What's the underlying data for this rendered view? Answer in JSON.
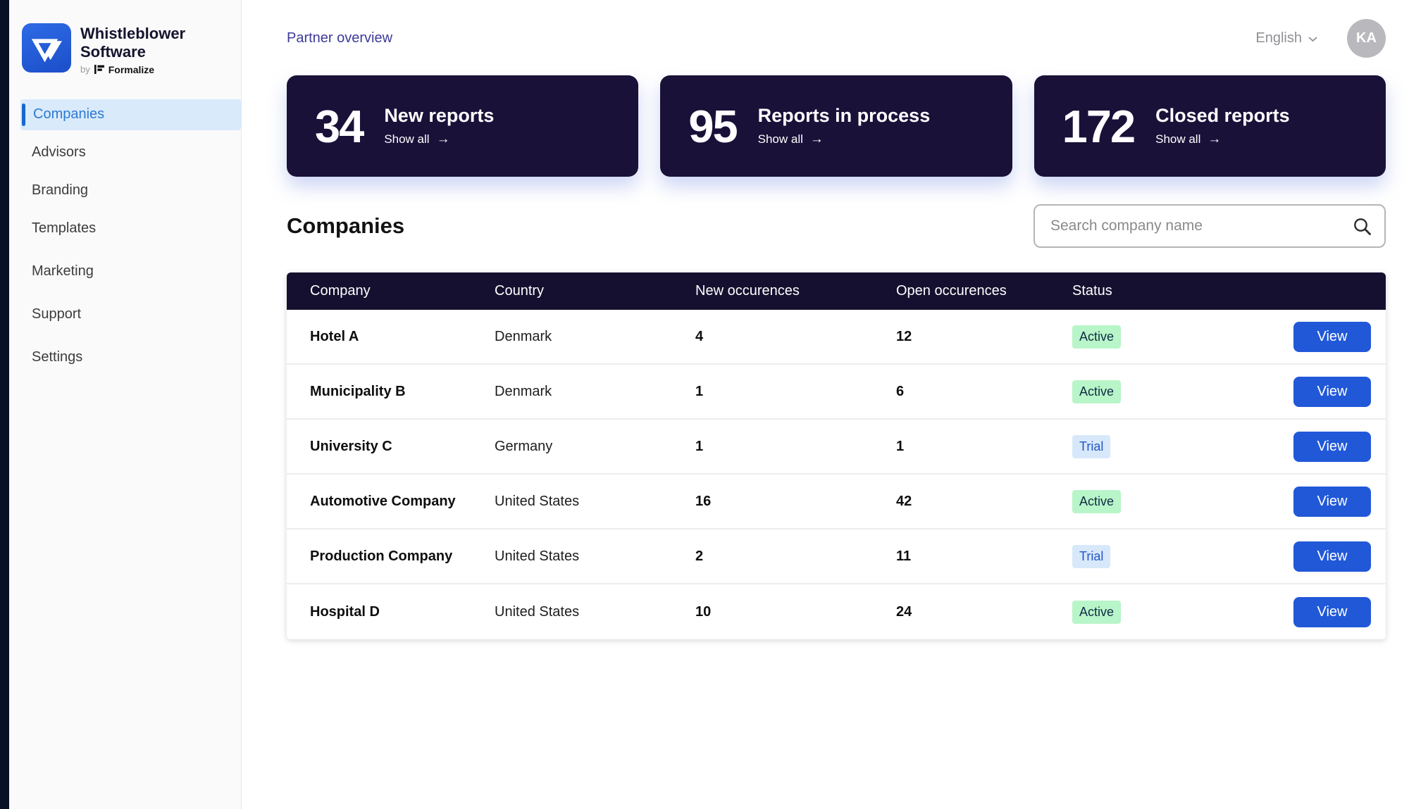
{
  "brand": {
    "name": "Whistleblower Software",
    "byline_prefix": "by",
    "byline_brand": "Formalize"
  },
  "sidebar": {
    "items": [
      {
        "label": "Companies",
        "active": true
      },
      {
        "label": "Advisors",
        "active": false
      },
      {
        "label": "Branding",
        "active": false
      },
      {
        "label": "Templates",
        "active": false
      },
      {
        "label": "Marketing",
        "active": false
      },
      {
        "label": "Support",
        "active": false
      },
      {
        "label": "Settings",
        "active": false
      }
    ]
  },
  "header": {
    "breadcrumb": "Partner overview",
    "language": "English",
    "avatar_initials": "KA"
  },
  "stats": [
    {
      "value": "34",
      "label": "New reports",
      "link": "Show all"
    },
    {
      "value": "95",
      "label": "Reports in process",
      "link": "Show all"
    },
    {
      "value": "172",
      "label": "Closed reports",
      "link": "Show all"
    }
  ],
  "companies_section": {
    "title": "Companies",
    "search_placeholder": "Search company name"
  },
  "table": {
    "columns": [
      "Company",
      "Country",
      "New occurences",
      "Open occurences",
      "Status"
    ],
    "view_label": "View",
    "status_styles": {
      "Active": {
        "bg": "#b8f5c8",
        "text": "#102b46"
      },
      "Trial": {
        "bg": "#d8e8fb",
        "text": "#2456c4"
      }
    },
    "rows": [
      {
        "company": "Hotel A",
        "country": "Denmark",
        "new_occurences": "4",
        "open_occurences": "12",
        "status": "Active"
      },
      {
        "company": "Municipality B",
        "country": "Denmark",
        "new_occurences": "1",
        "open_occurences": "6",
        "status": "Active"
      },
      {
        "company": "University C",
        "country": "Germany",
        "new_occurences": "1",
        "open_occurences": "1",
        "status": "Trial"
      },
      {
        "company": "Automotive Company",
        "country": "United States",
        "new_occurences": "16",
        "open_occurences": "42",
        "status": "Active"
      },
      {
        "company": "Production Company",
        "country": "United States",
        "new_occurences": "2",
        "open_occurences": "11",
        "status": "Trial"
      },
      {
        "company": "Hospital D",
        "country": "United States",
        "new_occurences": "10",
        "open_occurences": "24",
        "status": "Active"
      }
    ]
  },
  "colors": {
    "accent_blue": "#2158d8",
    "dark_navy": "#1a1139",
    "table_header_navy": "#15102f",
    "left_rail_navy": "#071024",
    "active_nav_bg": "#d9eafb",
    "active_nav_text": "#2d7ad3",
    "active_nav_bar": "#1766cc",
    "breadcrumb_indigo": "#3d3a99",
    "badge_active_bg": "#b8f5c8",
    "badge_active_text": "#102b46",
    "badge_trial_bg": "#d8e8fb",
    "badge_trial_text": "#2456c4",
    "logo_blue": "#2157d6"
  }
}
